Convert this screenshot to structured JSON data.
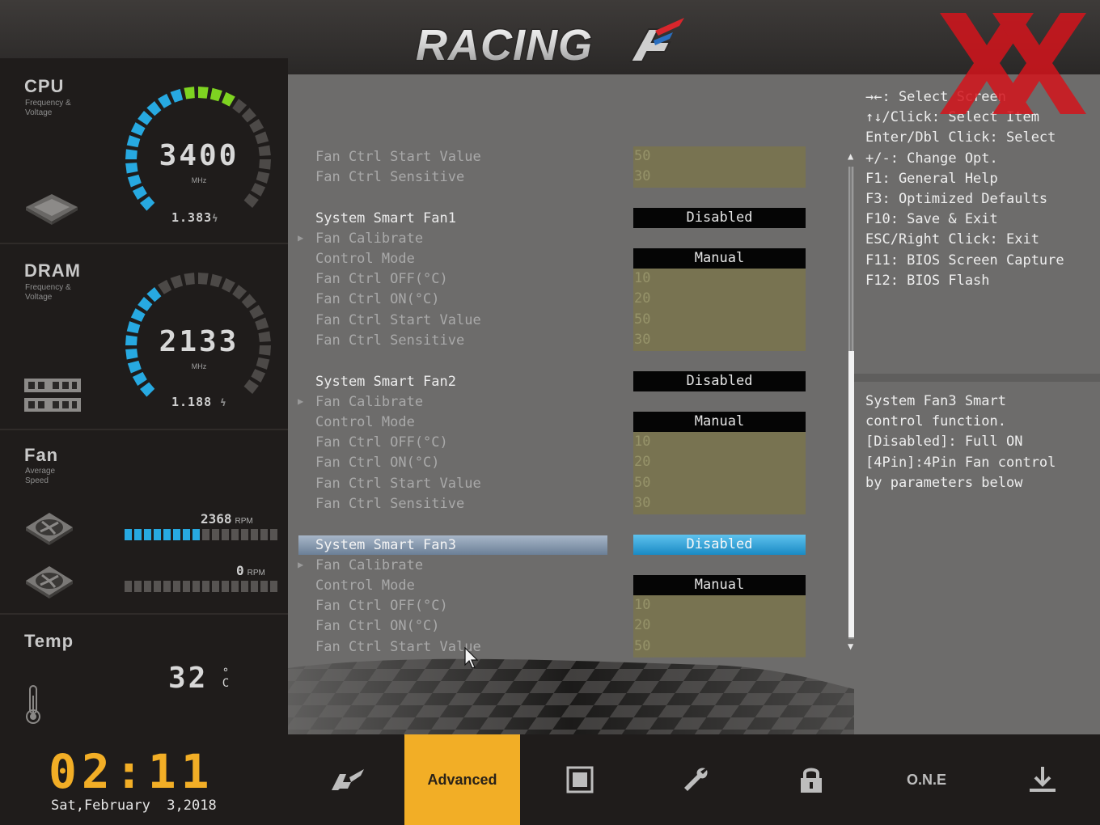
{
  "app": {
    "logo_text": "RACING"
  },
  "sidebar": {
    "cpu": {
      "title": "CPU",
      "subtitle": "Frequency & Voltage",
      "value": "3400",
      "unit": "MHz",
      "voltage": "1.383"
    },
    "dram": {
      "title": "DRAM",
      "subtitle": "Frequency & Voltage",
      "value": "2133",
      "unit": "MHz",
      "voltage": "1.188"
    },
    "fan": {
      "title": "Fan",
      "subtitle": "Average Speed",
      "fan1_rpm": "2368",
      "fan2_rpm": "0",
      "rpm_unit": "RPM",
      "fan1_level": 0.5,
      "fan2_level": 0.0
    },
    "temp": {
      "title": "Temp",
      "value": "32",
      "unit_deg": "°",
      "unit_c": "C"
    }
  },
  "settings": {
    "rows": [
      {
        "label": "Fan Ctrl Start Value",
        "value": "50",
        "kind": "box"
      },
      {
        "label": "Fan Ctrl Sensitive",
        "value": "30",
        "kind": "box"
      },
      {
        "label": "System Smart Fan1",
        "value": "Disabled",
        "kind": "btn",
        "head": true
      },
      {
        "label": "Fan Calibrate",
        "value": "",
        "kind": "sub"
      },
      {
        "label": "Control Mode",
        "value": "Manual",
        "kind": "btn"
      },
      {
        "label": "Fan Ctrl OFF(°C)",
        "value": "10",
        "kind": "box"
      },
      {
        "label": "Fan Ctrl ON(°C)",
        "value": "20",
        "kind": "box"
      },
      {
        "label": "Fan Ctrl Start Value",
        "value": "50",
        "kind": "box"
      },
      {
        "label": "Fan Ctrl Sensitive",
        "value": "30",
        "kind": "box"
      },
      {
        "label": "System Smart Fan2",
        "value": "Disabled",
        "kind": "btn",
        "head": true
      },
      {
        "label": "Fan Calibrate",
        "value": "",
        "kind": "sub"
      },
      {
        "label": "Control Mode",
        "value": "Manual",
        "kind": "btn"
      },
      {
        "label": "Fan Ctrl OFF(°C)",
        "value": "10",
        "kind": "box"
      },
      {
        "label": "Fan Ctrl ON(°C)",
        "value": "20",
        "kind": "box"
      },
      {
        "label": "Fan Ctrl Start Value",
        "value": "50",
        "kind": "box"
      },
      {
        "label": "Fan Ctrl Sensitive",
        "value": "30",
        "kind": "box"
      },
      {
        "label": "System Smart Fan3",
        "value": "Disabled",
        "kind": "btn",
        "head": true,
        "selected": true
      },
      {
        "label": "Fan Calibrate",
        "value": "",
        "kind": "sub"
      },
      {
        "label": "Control Mode",
        "value": "Manual",
        "kind": "btn"
      },
      {
        "label": "Fan Ctrl OFF(°C)",
        "value": "10",
        "kind": "box"
      },
      {
        "label": "Fan Ctrl ON(°C)",
        "value": "20",
        "kind": "box"
      },
      {
        "label": "Fan Ctrl Start Value",
        "value": "50",
        "kind": "box"
      }
    ]
  },
  "help": {
    "keys": [
      "→←: Select Screen",
      "↑↓/Click: Select Item",
      "Enter/Dbl Click: Select",
      "+/-: Change Opt.",
      "F1: General Help",
      "F3: Optimized Defaults",
      "F10: Save & Exit",
      "ESC/Right Click: Exit",
      "F11: BIOS Screen Capture",
      "F12: BIOS Flash"
    ],
    "description": [
      "System Fan3 Smart",
      "control function.",
      "[Disabled]: Full ON",
      "[4Pin]:4Pin Fan control",
      "by parameters below"
    ]
  },
  "footer": {
    "time": "02:11",
    "date": "Sat,February  3,2018",
    "nav": [
      {
        "id": "main",
        "icon": "racing-logo-icon"
      },
      {
        "id": "advanced",
        "label": "Advanced",
        "active": true
      },
      {
        "id": "chipset",
        "icon": "chip-icon"
      },
      {
        "id": "tools",
        "icon": "wrench-icon"
      },
      {
        "id": "security",
        "icon": "lock-icon"
      },
      {
        "id": "one",
        "label": "O.N.E"
      },
      {
        "id": "exit",
        "icon": "download-icon"
      }
    ]
  },
  "colors": {
    "accent": "#f2ae26",
    "selection": "#27a9e1",
    "panel": "#6d6c6b",
    "value_box": "#787351"
  }
}
